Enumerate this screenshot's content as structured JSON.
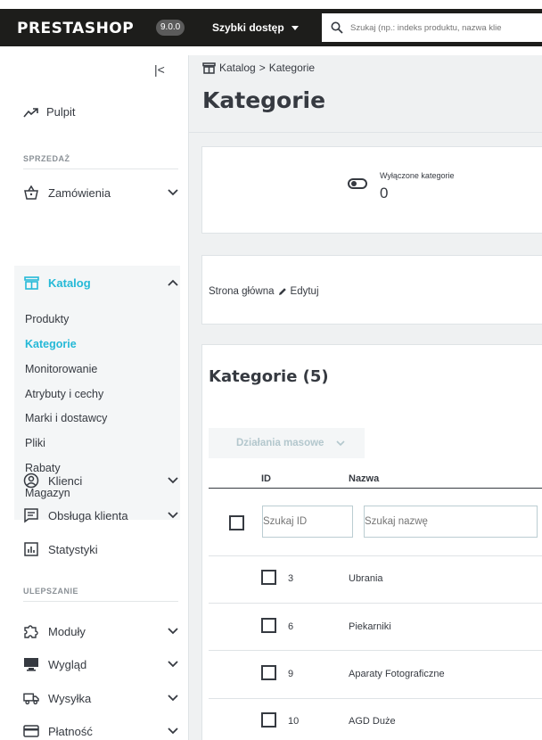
{
  "header": {
    "logo": "PRESTASHOP",
    "version": "9.0.0",
    "quick_access": "Szybki dostęp",
    "search_placeholder": "Szukaj (np.: indeks produktu, nazwa klie"
  },
  "sidebar": {
    "dashboard": "Pulpit",
    "section_sales": "SPRZEDAŻ",
    "orders": "Zamówienia",
    "catalog": "Katalog",
    "catalog_items": [
      "Produkty",
      "Kategorie",
      "Monitorowanie",
      "Atrybuty i cechy",
      "Marki i dostawcy",
      "Pliki",
      "Rabaty",
      "Magazyn"
    ],
    "customers": "Klienci",
    "customer_service": "Obsługa klienta",
    "stats": "Statystyki",
    "section_improve": "ULEPSZANIE",
    "modules": "Moduły",
    "design": "Wygląd",
    "shipping": "Wysyłka",
    "payment": "Płatność"
  },
  "page": {
    "breadcrumb_root": "Katalog",
    "breadcrumb_sep": ">",
    "breadcrumb_current": "Kategorie",
    "title": "Kategorie"
  },
  "kpi": {
    "label": "Wyłączone kategorie",
    "value": "0"
  },
  "home_card": {
    "text": "Strona główna",
    "edit": "Edytuj"
  },
  "list": {
    "title": "Kategorie (5)",
    "bulk_actions": "Działania masowe",
    "col_id": "ID",
    "col_name": "Nazwa",
    "filter_id_placeholder": "Szukaj ID",
    "filter_name_placeholder": "Szukaj nazwę",
    "rows": [
      {
        "id": "3",
        "name": "Ubrania"
      },
      {
        "id": "6",
        "name": "Piekarniki"
      },
      {
        "id": "9",
        "name": "Aparaty Fotograficzne"
      },
      {
        "id": "10",
        "name": "AGD Duże"
      }
    ]
  },
  "colors": {
    "accent": "#25b9d7",
    "topbar": "#1d1d1b",
    "text": "#363a41"
  }
}
